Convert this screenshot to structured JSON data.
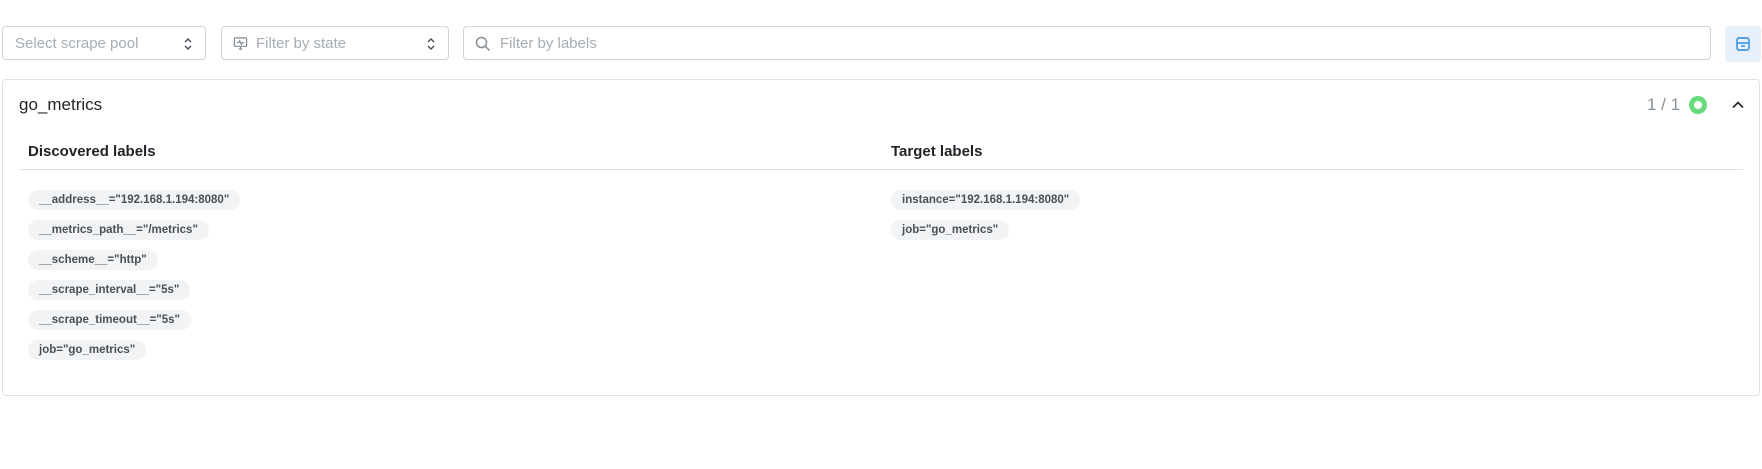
{
  "filters": {
    "scrape_pool_placeholder": "Select scrape pool",
    "state_placeholder": "Filter by state",
    "labels_placeholder": "Filter by labels"
  },
  "pool": {
    "name": "go_metrics",
    "count": "1 / 1",
    "health_color": "#69db7c",
    "discovered_heading": "Discovered labels",
    "target_heading": "Target labels",
    "discovered_labels": [
      "__address__=\"192.168.1.194:8080\"",
      "__metrics_path__=\"/metrics\"",
      "__scheme__=\"http\"",
      "__scrape_interval__=\"5s\"",
      "__scrape_timeout__=\"5s\"",
      "job=\"go_metrics\""
    ],
    "target_labels": [
      "instance=\"192.168.1.194:8080\"",
      "job=\"go_metrics\""
    ]
  },
  "icons": {
    "state_filter": "monitor-health-icon",
    "search": "search-icon",
    "collapse_all": "collapse-all-icon",
    "pool_toggle": "chevron-up-icon"
  }
}
